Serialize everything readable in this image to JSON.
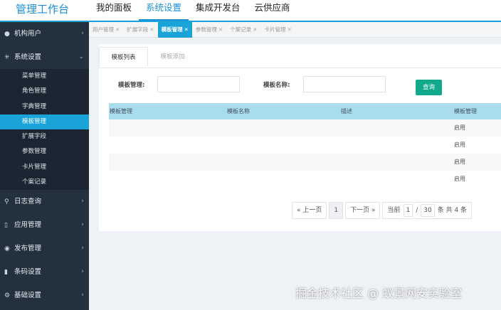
{
  "app": {
    "title": "管理工作台"
  },
  "topnav": [
    "我的面板",
    "系统设置",
    "集成开发台",
    "云供应商"
  ],
  "sidebar": {
    "groups_top": [
      {
        "label": "机构用户",
        "icon": "user-icon"
      },
      {
        "label": "系统设置",
        "icon": "gear-icon"
      }
    ],
    "submenu": [
      "菜单管理",
      "角色管理",
      "字典管理",
      "模板管理",
      "扩展字段",
      "参数管理",
      "卡片管理",
      "个案记录"
    ],
    "groups_bottom": [
      {
        "label": "日志查询",
        "icon": "search-icon"
      },
      {
        "label": "应用管理",
        "icon": "mobile-icon"
      },
      {
        "label": "发布管理",
        "icon": "eye-icon"
      },
      {
        "label": "条码设置",
        "icon": "barcode-icon"
      },
      {
        "label": "基础设置",
        "icon": "settings-icon"
      }
    ]
  },
  "tabs": [
    "用户管理",
    "扩展字段",
    "模板管理",
    "参数管理",
    "个案记录",
    "卡片管理"
  ],
  "card": {
    "tabs": [
      "模板列表",
      "模板添加"
    ],
    "filters": {
      "template_manage_label": "模板管理:",
      "template_name_label": "模板名称:",
      "template_manage_value": "",
      "template_name_value": ""
    },
    "query_button": "查询",
    "columns": [
      "模板管理",
      "模板名称",
      "描述",
      "模板管理"
    ],
    "rows": [
      [
        "",
        "",
        "",
        "启用"
      ],
      [
        "",
        "",
        "",
        "启用"
      ],
      [
        "",
        "",
        "",
        "启用"
      ],
      [
        "",
        "",
        "",
        "启用"
      ]
    ],
    "pager": {
      "prev": "« 上一页",
      "page": "1",
      "next": "下一页 »",
      "current_label": "当前",
      "current_page": "1",
      "separator": "/",
      "page_size": "30",
      "total": "条 共 4 条"
    }
  },
  "watermark": "掘金技术社区 @ 蚁景网安实验室",
  "colors": {
    "accent": "#1aa3d8",
    "sidebar": "#23303d",
    "query_button": "#12a88a",
    "table_header": "#a9dcef"
  }
}
